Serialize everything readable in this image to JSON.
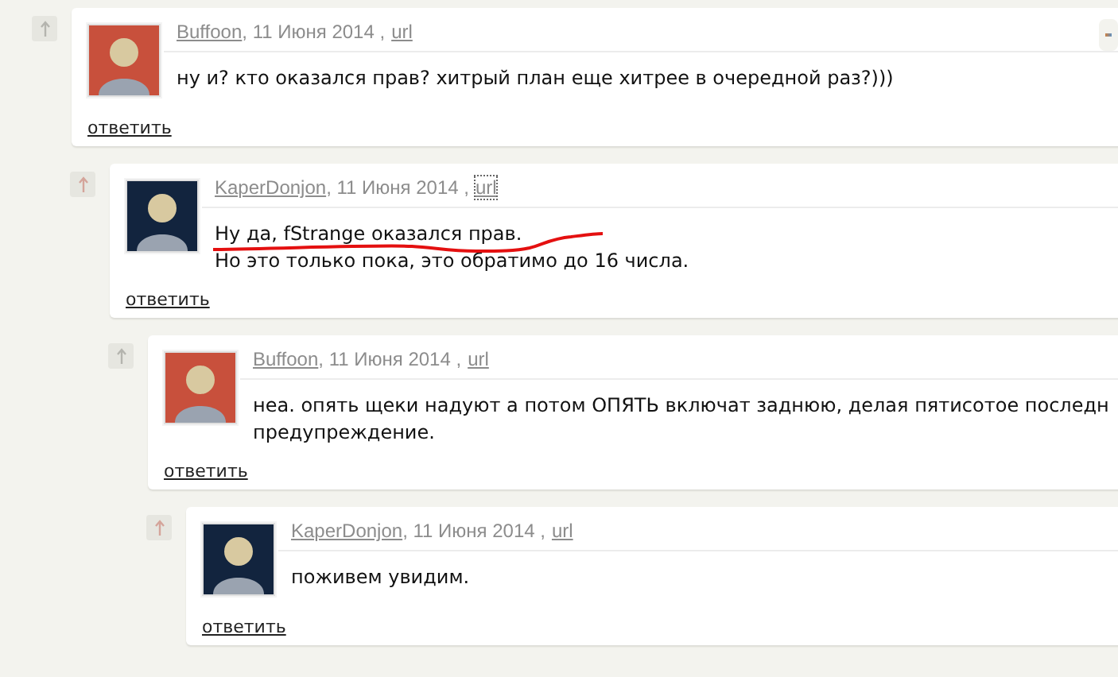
{
  "comments": [
    {
      "author": "Buffoon",
      "date": ", 11 Июня 2014 ,",
      "link": {
        "label": "url",
        "focused": false
      },
      "color": "#c8503c",
      "upvoted": false,
      "side_button": true,
      "lines": [
        "ну и? кто оказался прав? хитрый план еще хитрее в очередной раз?)))"
      ],
      "reply": "ответить",
      "children": [
        {
          "author": "KaperDonjon",
          "date": ", 11 Июня 2014 ,",
          "link": {
            "label": "url",
            "focused": true
          },
          "color": "#12243e",
          "upvoted": true,
          "lines": [
            "Ну да, fStrange оказался прав.",
            "Но это только пока, это обратимо до 16 числа."
          ],
          "reply": "ответить",
          "underline": true,
          "children": [
            {
              "author": "Buffoon",
              "date": ", 11 Июня 2014 ,",
              "link": {
                "label": "url",
                "focused": false
              },
              "color": "#c8503c",
              "upvoted": false,
              "lines": [
                "неа. опять щеки надуют а потом ОПЯТЬ включат заднюю, делая пятисотое последн",
                "предупреждение."
              ],
              "reply": "ответить",
              "children": [
                {
                  "author": "KaperDonjon",
                  "date": ", 11 Июня 2014 ,",
                  "link": {
                    "label": "url",
                    "focused": false
                  },
                  "color": "#12243e",
                  "upvoted": true,
                  "lines": [
                    "поживем увидим."
                  ],
                  "reply": "ответить"
                }
              ]
            }
          ]
        }
      ]
    }
  ]
}
